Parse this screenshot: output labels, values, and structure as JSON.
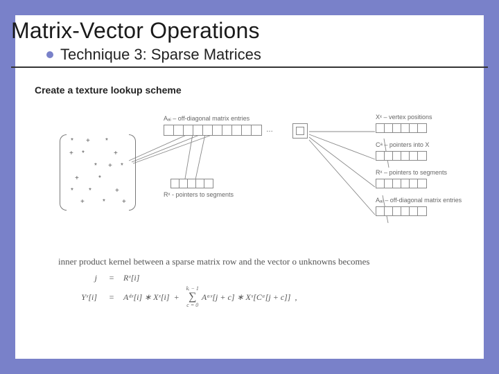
{
  "title": "Matrix-Vector Operations",
  "subtitle": "Technique 3: Sparse Matrices",
  "description": "Create a texture lookup scheme",
  "diagram": {
    "label_offdiag1": "Aₐᵢ – off-diagonal matrix entries",
    "label_ptrseg": "Rˣ - pointers to segments",
    "label_vx": "Xˣ – vertex positions",
    "label_ptrx": "Cᵃ – pointers into X",
    "label_ptrseg2": "Rˣ – pointers to segments",
    "label_offdiag2": "Aₐᵢ – off-diagonal matrix entries",
    "ellipsis": "…"
  },
  "formula": {
    "lead": "inner product kernel between a sparse matrix row and the vector o unknowns becomes",
    "row1_lhs": "j",
    "row1_rhs": "Rˣ[i]",
    "row2_lhs": "Yˣ[i]",
    "row2_termA": "Aᵈˣ[i] ∗ Xˣ[i]",
    "sigma_top": "kᵢ − 1",
    "sigma_bot": "c = 0",
    "row2_termB": "Aᵃˣ[j + c] ∗ Xˣ[Cᵃ[j + c]]",
    "eq": "=",
    "plus": "+",
    "comma": ","
  }
}
